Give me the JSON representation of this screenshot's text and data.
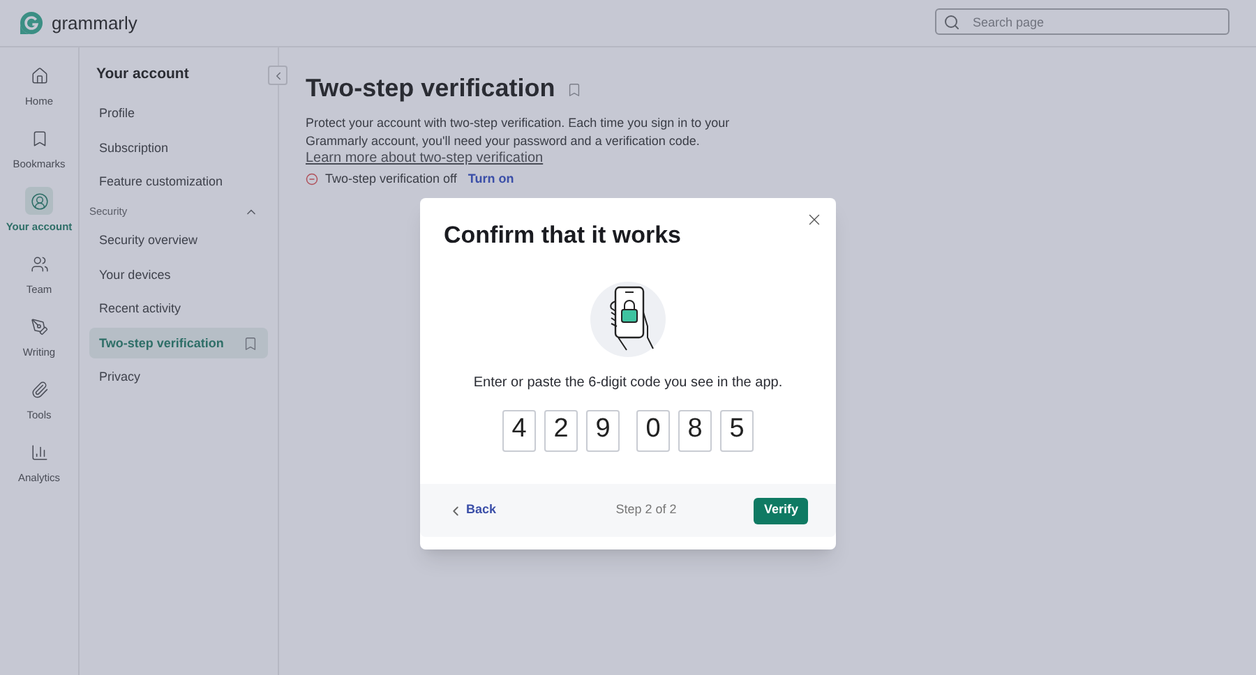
{
  "header": {
    "logo_text": "grammarly",
    "search": {
      "placeholder": "Search page"
    }
  },
  "rail": [
    {
      "label": "Home",
      "kind": "home",
      "selected": false
    },
    {
      "label": "Bookmarks",
      "kind": "bookmark",
      "selected": false
    },
    {
      "label": "Your account",
      "kind": "account",
      "selected": true
    },
    {
      "label": "Team",
      "kind": "team",
      "selected": false
    },
    {
      "label": "Writing",
      "kind": "writing",
      "selected": false
    },
    {
      "label": "Tools",
      "kind": "tools",
      "selected": false
    },
    {
      "label": "Analytics",
      "kind": "analytics",
      "selected": false
    }
  ],
  "nav": {
    "title": "Your account",
    "items": [
      {
        "label": "Profile",
        "selected": false
      },
      {
        "label": "Subscription",
        "selected": false
      },
      {
        "label": "Feature customization",
        "selected": false
      }
    ],
    "section": {
      "label": "Security",
      "expanded": true,
      "items": [
        {
          "label": "Security overview",
          "selected": false
        },
        {
          "label": "Your devices",
          "selected": false
        },
        {
          "label": "Recent activity",
          "selected": false
        },
        {
          "label": "Two-step verification",
          "selected": true
        },
        {
          "label": "Privacy",
          "selected": false
        }
      ]
    }
  },
  "main": {
    "title": "Two-step verification",
    "description": "Protect your account with two-step verification. Each time you sign in to your Grammarly account, you'll need your password and a verification code.",
    "link": "Learn more about two-step verification",
    "status": "Two-step verification off",
    "status_action": "Turn on"
  },
  "modal": {
    "title": "Confirm that it works",
    "instruction": "Enter or paste the 6-digit code you see in the app.",
    "code": [
      "4",
      "2",
      "9",
      "0",
      "8",
      "5"
    ],
    "back": "Back",
    "step": "Step 2 of 2",
    "verify": "Verify"
  }
}
